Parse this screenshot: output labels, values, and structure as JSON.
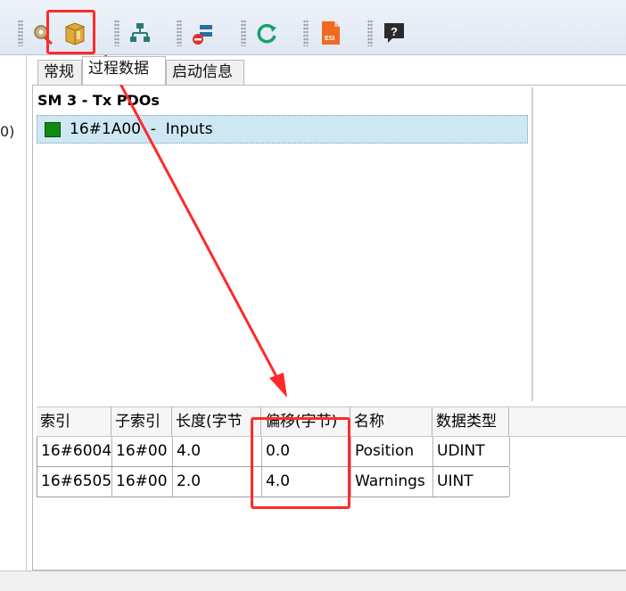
{
  "toolbar": {
    "icons": [
      "config-gear-icon",
      "package-icon",
      "network-tree-icon",
      "remove-device-icon",
      "refresh-icon",
      "esi-file-icon",
      "help-icon"
    ],
    "esi_label": "ESI",
    "help_label": "?"
  },
  "left_pane": {
    "fragment": "0)"
  },
  "tabs": [
    {
      "label": "常规"
    },
    {
      "label": "过程数据"
    },
    {
      "label": "启动信息"
    }
  ],
  "sm": {
    "title": "SM 3 - Tx PDOs",
    "pdo_label": "16#1A00  -  Inputs"
  },
  "table": {
    "headers": [
      "索引",
      "子索引",
      "长度(字节",
      "偏移(字节)",
      "名称",
      "数据类型"
    ],
    "rows": [
      [
        "16#6004",
        "16#00",
        "4.0",
        "0.0",
        "Position",
        "UDINT"
      ],
      [
        "16#6505",
        "16#00",
        "2.0",
        "4.0",
        "Warnings",
        "UINT"
      ]
    ]
  },
  "colors": {
    "highlight": "#ff2a2a",
    "selection": "#cde8f3",
    "pdo_indicator": "#108a10"
  }
}
